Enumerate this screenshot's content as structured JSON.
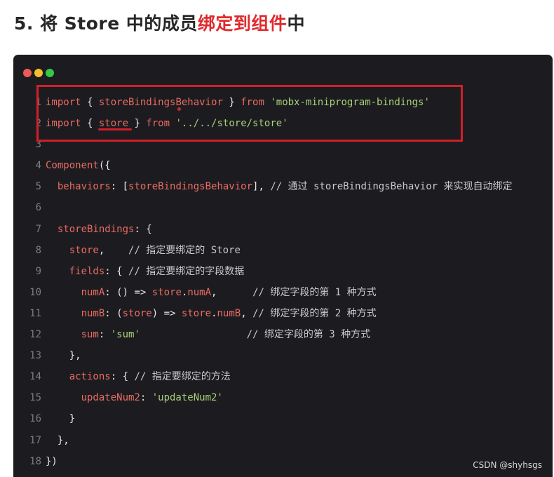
{
  "heading": {
    "prefix": "5. 将 Store 中的成员",
    "highlight": "绑定到组件",
    "suffix": "中"
  },
  "code_lines": [
    [
      {
        "t": "import",
        "c": "kw"
      },
      {
        "t": " { ",
        "c": "p"
      },
      {
        "t": "storeBindingsBehavior",
        "c": "kw"
      },
      {
        "t": " } ",
        "c": "p"
      },
      {
        "t": "from",
        "c": "kw"
      },
      {
        "t": " ",
        "c": "p"
      },
      {
        "t": "'mobx-miniprogram-bindings'",
        "c": "str"
      }
    ],
    [
      {
        "t": "import",
        "c": "kw"
      },
      {
        "t": " { ",
        "c": "p"
      },
      {
        "t": "store",
        "c": "kw"
      },
      {
        "t": " } ",
        "c": "p"
      },
      {
        "t": "from",
        "c": "kw"
      },
      {
        "t": " ",
        "c": "p"
      },
      {
        "t": "'../../store/store'",
        "c": "str"
      }
    ],
    [],
    [
      {
        "t": "Component",
        "c": "kw"
      },
      {
        "t": "({",
        "c": "p"
      }
    ],
    [
      {
        "t": "  behaviors",
        "c": "kw"
      },
      {
        "t": ": [",
        "c": "p"
      },
      {
        "t": "storeBindingsBehavior",
        "c": "kw"
      },
      {
        "t": "], ",
        "c": "p"
      },
      {
        "t": "// 通过 storeBindingsBehavior 来实现自动绑定",
        "c": "cm"
      }
    ],
    [],
    [
      {
        "t": "  storeBindings",
        "c": "kw"
      },
      {
        "t": ": {",
        "c": "p"
      }
    ],
    [
      {
        "t": "    store",
        "c": "kw"
      },
      {
        "t": ",    ",
        "c": "p"
      },
      {
        "t": "// 指定要绑定的 Store",
        "c": "cm"
      }
    ],
    [
      {
        "t": "    fields",
        "c": "kw"
      },
      {
        "t": ": { ",
        "c": "p"
      },
      {
        "t": "// 指定要绑定的字段数据",
        "c": "cm"
      }
    ],
    [
      {
        "t": "      numA",
        "c": "kw"
      },
      {
        "t": ": () => ",
        "c": "p"
      },
      {
        "t": "store",
        "c": "kw"
      },
      {
        "t": ".",
        "c": "p"
      },
      {
        "t": "numA",
        "c": "kw"
      },
      {
        "t": ",      ",
        "c": "p"
      },
      {
        "t": "// 绑定字段的第 1 种方式",
        "c": "cm"
      }
    ],
    [
      {
        "t": "      numB",
        "c": "kw"
      },
      {
        "t": ": (",
        "c": "p"
      },
      {
        "t": "store",
        "c": "kw"
      },
      {
        "t": ") => ",
        "c": "p"
      },
      {
        "t": "store",
        "c": "kw"
      },
      {
        "t": ".",
        "c": "p"
      },
      {
        "t": "numB",
        "c": "kw"
      },
      {
        "t": ", ",
        "c": "p"
      },
      {
        "t": "// 绑定字段的第 2 种方式",
        "c": "cm"
      }
    ],
    [
      {
        "t": "      sum",
        "c": "kw"
      },
      {
        "t": ": ",
        "c": "p"
      },
      {
        "t": "'sum'",
        "c": "str"
      },
      {
        "t": "                  ",
        "c": "p"
      },
      {
        "t": "// 绑定字段的第 3 种方式",
        "c": "cm"
      }
    ],
    [
      {
        "t": "    },",
        "c": "p"
      }
    ],
    [
      {
        "t": "    actions",
        "c": "kw"
      },
      {
        "t": ": { ",
        "c": "p"
      },
      {
        "t": "// 指定要绑定的方法",
        "c": "cm"
      }
    ],
    [
      {
        "t": "      updateNum2",
        "c": "kw"
      },
      {
        "t": ": ",
        "c": "p"
      },
      {
        "t": "'updateNum2'",
        "c": "str"
      }
    ],
    [
      {
        "t": "    }",
        "c": "p"
      }
    ],
    [
      {
        "t": "  },",
        "c": "p"
      }
    ],
    [
      {
        "t": "})",
        "c": "p"
      }
    ]
  ],
  "watermark": "CSDN @shyhsgs"
}
